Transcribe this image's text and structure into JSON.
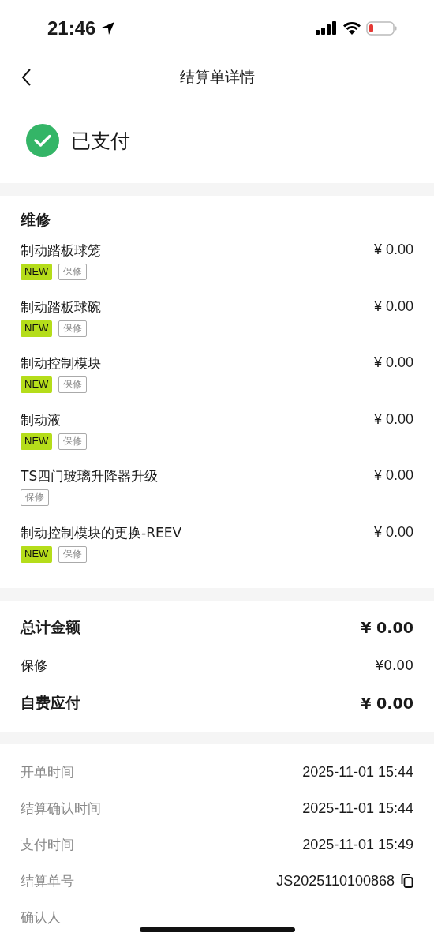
{
  "status_bar": {
    "time": "21:46"
  },
  "nav": {
    "title": "结算单详情"
  },
  "payment_status": {
    "label": "已支付"
  },
  "repair": {
    "heading": "维修",
    "items": [
      {
        "name": "制动踏板球笼",
        "price": "¥ 0.00",
        "tags": [
          {
            "kind": "new",
            "label": "NEW"
          },
          {
            "kind": "warranty",
            "label": "保修"
          }
        ]
      },
      {
        "name": "制动踏板球碗",
        "price": "¥ 0.00",
        "tags": [
          {
            "kind": "new",
            "label": "NEW"
          },
          {
            "kind": "warranty",
            "label": "保修"
          }
        ]
      },
      {
        "name": "制动控制模块",
        "price": "¥ 0.00",
        "tags": [
          {
            "kind": "new",
            "label": "NEW"
          },
          {
            "kind": "warranty",
            "label": "保修"
          }
        ]
      },
      {
        "name": "制动液",
        "price": "¥ 0.00",
        "tags": [
          {
            "kind": "new",
            "label": "NEW"
          },
          {
            "kind": "warranty",
            "label": "保修"
          }
        ]
      },
      {
        "name": "TS四门玻璃升降器升级",
        "price": "¥ 0.00",
        "tags": [
          {
            "kind": "warranty",
            "label": "保修"
          }
        ]
      },
      {
        "name": "制动控制模块的更换-REEV",
        "price": "¥ 0.00",
        "tags": [
          {
            "kind": "new",
            "label": "NEW"
          },
          {
            "kind": "warranty",
            "label": "保修"
          }
        ]
      }
    ]
  },
  "totals": [
    {
      "label": "总计金额",
      "value": "¥ 0.00",
      "emphasis": true
    },
    {
      "label": "保修",
      "value": "¥0.00",
      "emphasis": false
    },
    {
      "label": "自费应付",
      "value": "¥ 0.00",
      "emphasis": true
    }
  ],
  "info": [
    {
      "label": "开单时间",
      "value": "2025-11-01 15:44",
      "copyable": false
    },
    {
      "label": "结算确认时间",
      "value": "2025-11-01 15:44",
      "copyable": false
    },
    {
      "label": "支付时间",
      "value": "2025-11-01 15:49",
      "copyable": false
    },
    {
      "label": "结算单号",
      "value": "JS2025110100868",
      "copyable": true
    },
    {
      "label": "确认人",
      "copyable": false
    }
  ]
}
